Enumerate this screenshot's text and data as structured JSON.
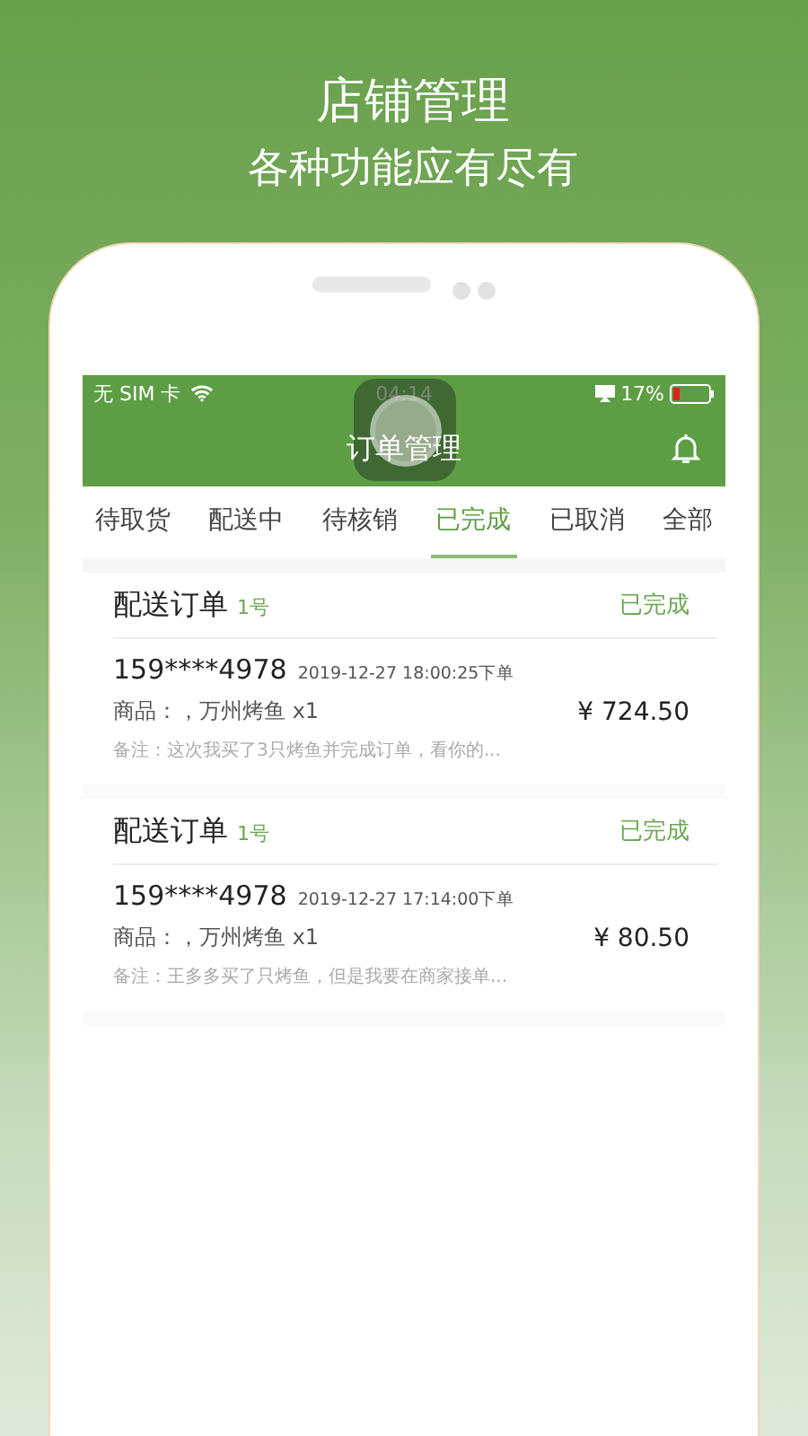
{
  "promo": {
    "title": "店铺管理",
    "subtitle": "各种功能应有尽有"
  },
  "status_bar": {
    "carrier": "无 SIM 卡",
    "time": "04:14",
    "battery": "17%"
  },
  "nav": {
    "title": "订单管理"
  },
  "tabs": [
    {
      "label": "待取货",
      "selected": false
    },
    {
      "label": "配送中",
      "selected": false
    },
    {
      "label": "待核销",
      "selected": false
    },
    {
      "label": "已完成",
      "selected": true
    },
    {
      "label": "已取消",
      "selected": false
    },
    {
      "label": "全部",
      "selected": false
    }
  ],
  "orders": [
    {
      "type": "配送订单",
      "number": "1号",
      "status": "已完成",
      "phone": "159****4978",
      "time": "2019-12-27 18:00:25下单",
      "goods": "商品：，万州烤鱼 x1",
      "price": "¥ 724.50",
      "note": "备注：这次我买了3只烤鱼并完成订单，看你的..."
    },
    {
      "type": "配送订单",
      "number": "1号",
      "status": "已完成",
      "phone": "159****4978",
      "time": "2019-12-27 17:14:00下单",
      "goods": "商品：，万州烤鱼 x1",
      "price": "¥ 80.50",
      "note": "备注：王多多买了只烤鱼，但是我要在商家接单..."
    }
  ]
}
